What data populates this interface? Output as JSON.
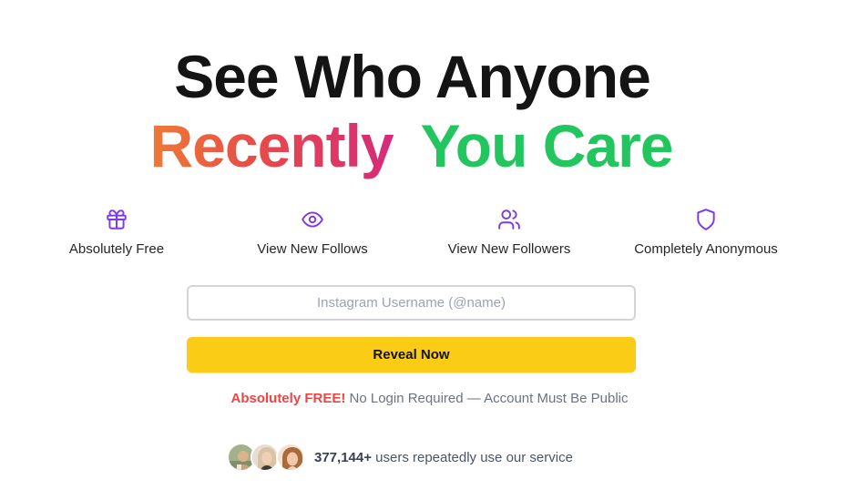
{
  "hero": {
    "line1": "See Who Anyone",
    "line2_gradient": "Recently",
    "line2_green": "You Care"
  },
  "features": [
    {
      "label": "Absolutely Free",
      "icon": "gift-icon"
    },
    {
      "label": "View New Follows",
      "icon": "eye-icon"
    },
    {
      "label": "View New Followers",
      "icon": "users-icon"
    },
    {
      "label": "Completely Anonymous",
      "icon": "shield-icon"
    }
  ],
  "search": {
    "placeholder": "Instagram Username (@name)",
    "value": ""
  },
  "reveal": {
    "label": "Reveal Now"
  },
  "notice": {
    "highlight": "Absolutely FREE!",
    "text": "No Login Required — Account Must Be Public"
  },
  "social": {
    "count": "377,144+",
    "text": "users repeatedly use our service"
  },
  "colors": {
    "accent_purple": "#7c3aed",
    "button_yellow": "#facc15",
    "green": "#22c55e",
    "red": "#ef4444"
  }
}
